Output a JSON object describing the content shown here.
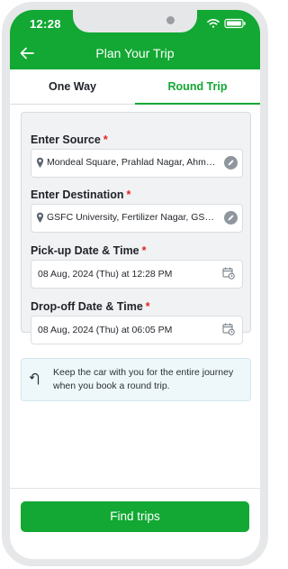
{
  "status_bar": {
    "time": "12:28"
  },
  "nav": {
    "title": "Plan Your Trip"
  },
  "tabs": [
    {
      "label": "One Way",
      "active": false
    },
    {
      "label": "Round Trip",
      "active": true
    }
  ],
  "form": {
    "source": {
      "label": "Enter Source",
      "required_mark": "*",
      "value": "Mondeal Square, Prahlad Nagar, Ahmedabad, Gujarat"
    },
    "destination": {
      "label": "Enter Destination",
      "required_mark": "*",
      "value": "GSFC University, Fertilizer Nagar, GSFC, Vadodara"
    },
    "pickup": {
      "label": "Pick-up Date & Time",
      "required_mark": "*",
      "value": "08 Aug, 2024 (Thu) at 12:28 PM"
    },
    "dropoff": {
      "label": "Drop-off Date & Time",
      "required_mark": "*",
      "value": "08 Aug, 2024 (Thu) at 06:05 PM"
    }
  },
  "info": {
    "icon": "u-turn-icon",
    "text": "Keep the car with you for the entire journey when you book a round trip."
  },
  "cta": {
    "label": "Find trips"
  },
  "colors": {
    "brand_green": "#12a833",
    "required_red": "#e02424",
    "card_bg": "#f1f2f3",
    "info_bg": "#eef8fb"
  }
}
